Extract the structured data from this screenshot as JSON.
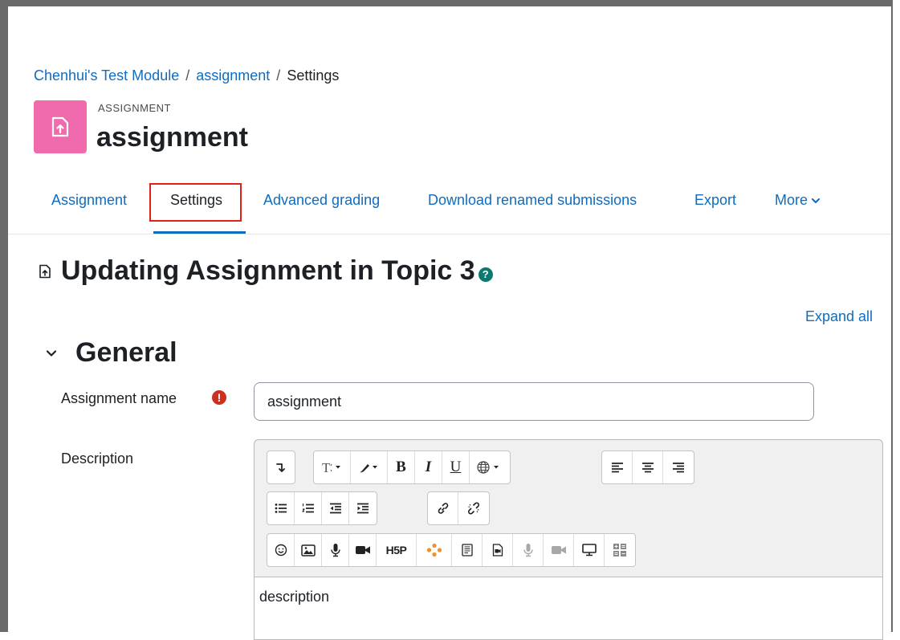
{
  "breadcrumb": {
    "items": [
      "Chenhui's Test Module",
      "assignment",
      "Settings"
    ],
    "separator": "/"
  },
  "header": {
    "pre_title": "ASSIGNMENT",
    "title": "assignment"
  },
  "tabs": [
    {
      "label": "Assignment",
      "active": false
    },
    {
      "label": "Settings",
      "active": true
    },
    {
      "label": "Advanced grading",
      "active": false
    },
    {
      "label": "Download renamed submissions",
      "active": false
    },
    {
      "label": "Export",
      "active": false
    },
    {
      "label": "More",
      "active": false
    }
  ],
  "page": {
    "heading": "Updating Assignment in Topic 3",
    "expand_all": "Expand all"
  },
  "section": {
    "title": "General"
  },
  "form": {
    "name_label": "Assignment name",
    "name_value": "assignment",
    "description_label": "Description",
    "description_value": "description"
  },
  "toolbar": {
    "row1": [
      "collapse-icon",
      "font-size-icon",
      "paint-brush-icon",
      "bold-icon",
      "italic-icon",
      "underline-icon",
      "language-icon",
      "align-left-icon",
      "align-center-icon",
      "align-right-icon"
    ],
    "bold_glyph": "B",
    "italic_glyph": "I",
    "underline_glyph": "U",
    "row2": [
      "unordered-list-icon",
      "ordered-list-icon",
      "outdent-icon",
      "indent-icon",
      "link-icon",
      "unlink-icon"
    ],
    "row3": [
      "emoji-icon",
      "image-icon",
      "record-audio-icon",
      "record-video-icon",
      "h5p-icon",
      "generico-icon",
      "template-icon",
      "media-icon",
      "record-audio-disabled-icon",
      "record-video-disabled-icon",
      "screen-icon",
      "table-icon"
    ],
    "h5p_label": "H5P"
  },
  "colors": {
    "link": "#0f6cbf",
    "icon_bg": "#f06bae",
    "required": "#ca3120",
    "help": "#0b7a6e",
    "highlight": "#e0201a",
    "generico": "#f0922b"
  }
}
